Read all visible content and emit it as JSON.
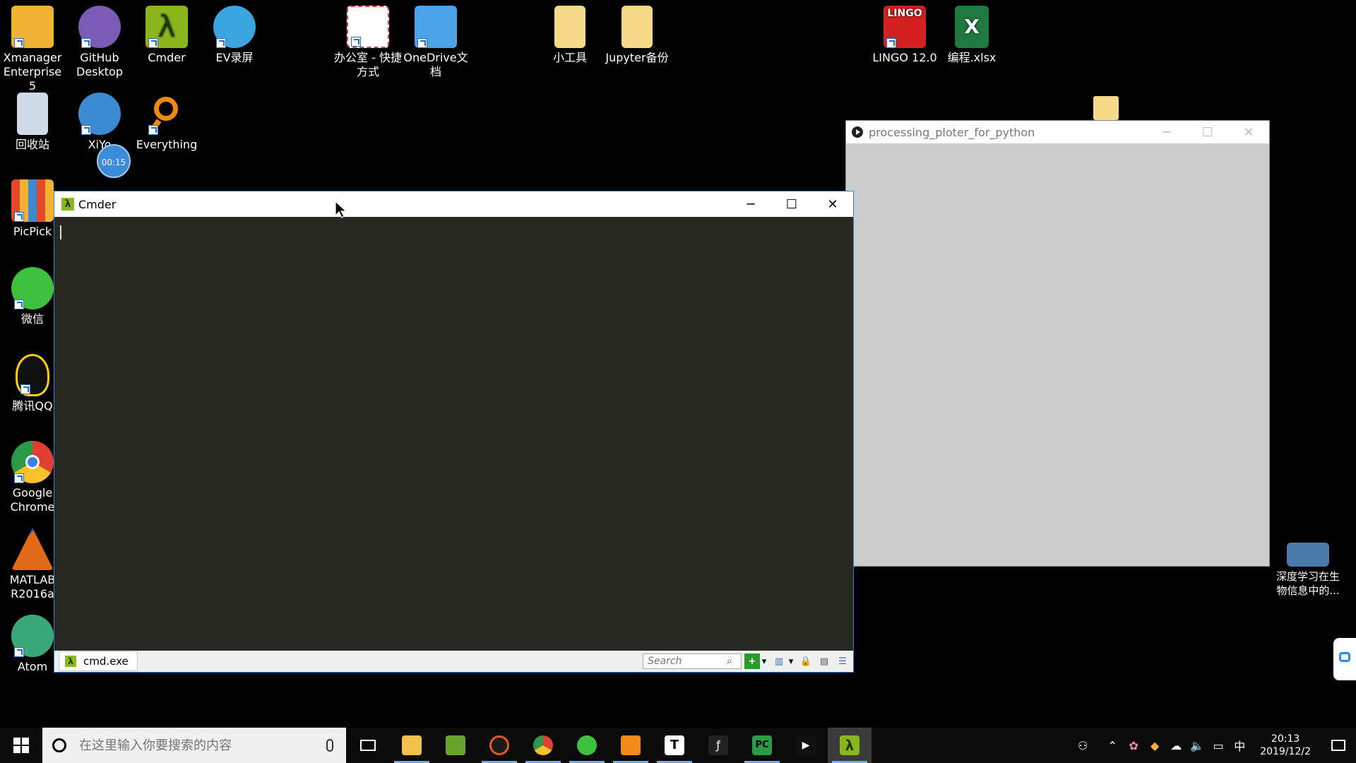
{
  "desktop_icons": [
    {
      "label": "Xmanager\nEnterprise 5",
      "color": "#f2b233"
    },
    {
      "label": "GitHub\nDesktop",
      "color": "#7b5bb5"
    },
    {
      "label": "Cmder",
      "color": "#8bb61d"
    },
    {
      "label": "EV录屏",
      "color": "#3aa6e0"
    },
    {
      "label": "办公室 - 快捷\n方式",
      "color": "#ffffff"
    },
    {
      "label": "OneDrive文\n档",
      "color": "#4aa3e8"
    },
    {
      "label": "小工具",
      "color": "#f7d98a"
    },
    {
      "label": "Jupyter备份",
      "color": "#f7d98a"
    },
    {
      "label": "LINGO 12.0",
      "color": "#d42020"
    },
    {
      "label": "编程.xlsx",
      "color": "#1e7a3e"
    },
    {
      "label": "回收站",
      "color": "#cfdbe6"
    },
    {
      "label": "XiYo",
      "color": "#3a8ad4"
    },
    {
      "label": "Everything",
      "color": "#f08a0a"
    },
    {
      "label": "PicPick",
      "color": "#e04a2a"
    },
    {
      "label": "微信",
      "color": "#3ec23e"
    },
    {
      "label": "腾讯QQ",
      "color": "#ffd000"
    },
    {
      "label": "Google\nChrome",
      "color": "#de4032"
    },
    {
      "label": "MATLAB\nR2016a",
      "color": "#e06a1a"
    },
    {
      "label": "Atom",
      "color": "#3aa87a"
    },
    {
      "label": "深度学习在生\n物信息中的...",
      "color": "#4a7aa8"
    }
  ],
  "timer_badge": "00:15",
  "cmder_window": {
    "title": "Cmder",
    "tab_label": "cmd.exe",
    "search_placeholder": "Search",
    "minimize": "─",
    "maximize": "☐",
    "close": "✕"
  },
  "processing_window": {
    "title": "processing_ploter_for_python",
    "minimize": "─",
    "maximize": "☐",
    "close": "✕"
  },
  "taskbar": {
    "search_placeholder": "在这里输入你要搜索的内容",
    "apps": [
      {
        "name": "task-view",
        "color": "#333333"
      },
      {
        "name": "file-explorer",
        "color": "#f2c14e"
      },
      {
        "name": "nvidia",
        "color": "#6aa32b"
      },
      {
        "name": "eclipse",
        "color": "#e05a1a"
      },
      {
        "name": "chrome",
        "color": "#de4032"
      },
      {
        "name": "wechat",
        "color": "#3ec23e"
      },
      {
        "name": "pdf-reader",
        "color": "#f28a1a"
      },
      {
        "name": "typora",
        "color": "#ffffff"
      },
      {
        "name": "unknown-app",
        "color": "#222222"
      },
      {
        "name": "pycharm",
        "color": "#2b9a48"
      },
      {
        "name": "media-player",
        "color": "#111111"
      },
      {
        "name": "cmder",
        "color": "#8bb61d"
      }
    ],
    "clock_time": "20:13",
    "clock_date": "2019/12/2",
    "ime": "中"
  }
}
